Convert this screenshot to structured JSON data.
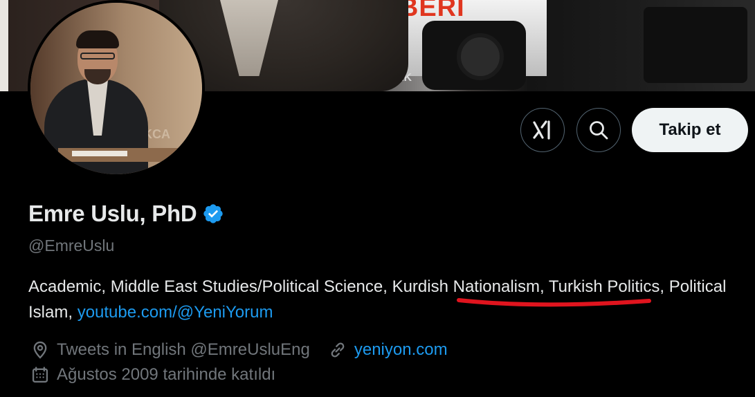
{
  "banner": {
    "overlay_text": "HABERİ",
    "small_text": "AK"
  },
  "avatar": {
    "wall_text": "NKCA"
  },
  "header_actions": {
    "grok_icon": "grok-icon",
    "search_icon": "search-icon",
    "follow_label": "Takip et"
  },
  "profile": {
    "name": "Emre Uslu, PhD",
    "verified_icon": "verified-badge-icon",
    "handle": "@EmreUslu",
    "bio_text_1": "Academic, Middle East Studies/Political Science, Kurdish Nationalism, Turkish Politics, Political Islam, ",
    "bio_link": "youtube.com/@YeniYorum",
    "location_icon": "location-pin-icon",
    "location": "Tweets in English @EmreUsluEng",
    "website_icon": "link-icon",
    "website": "yeniyon.com",
    "joined_icon": "calendar-icon",
    "joined": "Ağustos 2009 tarihinde katıldı"
  },
  "colors": {
    "accent": "#1d9bf0",
    "muted": "#71767b",
    "annotation": "#e0141e"
  }
}
